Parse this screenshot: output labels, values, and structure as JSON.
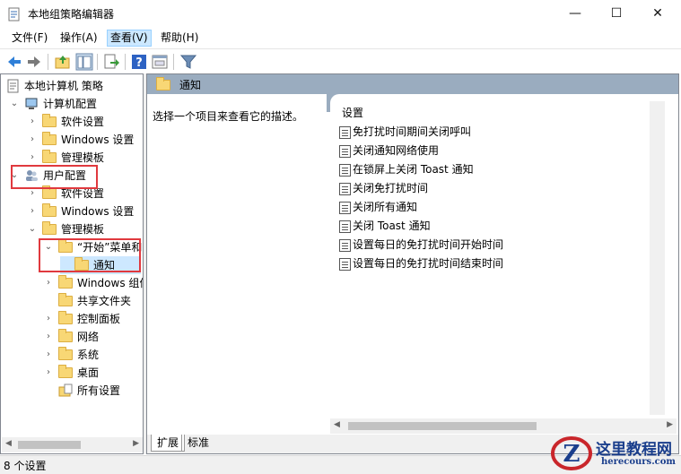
{
  "window": {
    "title": "本地组策略编辑器",
    "minimize": "—",
    "maximize": "☐",
    "close": "✕"
  },
  "menu": {
    "file": "文件(F)",
    "action": "操作(A)",
    "view": "查看(V)",
    "help": "帮助(H)"
  },
  "toolbar": {
    "icons": [
      "back-icon",
      "forward-icon",
      "up-folder-icon",
      "show-hide-tree-icon",
      "export-list-icon",
      "help-icon",
      "properties-icon",
      "filter-icon"
    ]
  },
  "tree": {
    "root": "本地计算机 策略",
    "computer_config": "计算机配置",
    "cc_software": "软件设置",
    "cc_windows": "Windows 设置",
    "cc_admin": "管理模板",
    "user_config": "用户配置",
    "uc_software": "软件设置",
    "uc_windows": "Windows 设置",
    "uc_admin": "管理模板",
    "start_menu": "“开始”菜单和",
    "notifications": "通知",
    "windows_components": "Windows 组件",
    "shared_folders": "共享文件夹",
    "control_panel": "控制面板",
    "network": "网络",
    "system": "系统",
    "desktop": "桌面",
    "all_settings": "所有设置"
  },
  "right": {
    "header_title": "通知",
    "description": "选择一个项目来查看它的描述。",
    "column_setting": "设置",
    "items": [
      "免打扰时间期间关闭呼叫",
      "关闭通知网络使用",
      "在锁屏上关闭 Toast 通知",
      "关闭免打扰时间",
      "关闭所有通知",
      "关闭 Toast 通知",
      "设置每日的免打扰时间开始时间",
      "设置每日的免打扰时间结束时间"
    ]
  },
  "tabs": {
    "extended": "扩展",
    "standard": "标准"
  },
  "status": {
    "text": "8 个设置"
  },
  "watermark": {
    "line1": "这里教程网",
    "line2": "herecours.com"
  },
  "colors": {
    "highlight": "#e0393e",
    "header_bg": "#9aacbf",
    "menu_active": "#cce8ff"
  }
}
